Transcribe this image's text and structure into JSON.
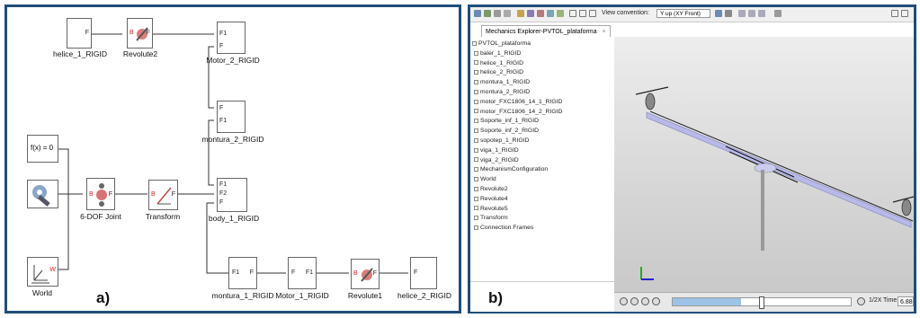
{
  "panel_a": {
    "tag": "a)",
    "blocks": {
      "helice_1": {
        "name": "helice_1_RIGID",
        "port": "F"
      },
      "revolute2": {
        "name": "Revolute2",
        "port_b": "B",
        "port_f": "F"
      },
      "motor_2": {
        "name": "Motor_2_RIGID",
        "port1": "F1",
        "port2": "F"
      },
      "montura_2": {
        "name": "montura_2_RIGID",
        "port1": "F",
        "port2": "F1"
      },
      "fx": {
        "label": "f(x) = 0"
      },
      "solver": {
        "name": ""
      },
      "dof6": {
        "name": "6-DOF Joint",
        "port_b": "B",
        "port_f": "F"
      },
      "transform": {
        "name": "Transform",
        "port_b": "B",
        "port_f": "F"
      },
      "body_1": {
        "name": "body_1_RIGID",
        "port1": "F1",
        "port2": "F2",
        "port3": "F"
      },
      "world": {
        "name": "World",
        "port": "W"
      },
      "montura_1": {
        "name": "montura_1_RIGID",
        "port1": "F1",
        "port2": "F"
      },
      "motor_1": {
        "name": "Motor_1_RIGID",
        "port1": "F",
        "port2": "F1"
      },
      "revolute1": {
        "name": "Revolute1",
        "port_b": "B",
        "port_f": "F"
      },
      "helice_2": {
        "name": "helice_2_RIGID",
        "port": "F"
      }
    }
  },
  "panel_b": {
    "tag": "b)",
    "toolbar": {
      "view_convention_label": "View convention:",
      "view_convention_value": "Y up (XY Front)"
    },
    "tab_label": "Mechanics Explorer-PVTOL_plataforma",
    "tree": [
      "PVTOL_plataforma",
      "baler_1_RIGID",
      "helice_1_RIGID",
      "helice_2_RIGID",
      "montura_1_RIGID",
      "montura_2_RIGID",
      "motor_FXC1806_14_1_RIGID",
      "motor_FXC1806_14_2_RIGID",
      "Soporte_inf_1_RIGID",
      "Soporte_inf_2_RIGID",
      "sopotep_1_RIGID",
      "viga_1_RIGID",
      "viga_2_RIGID",
      "MechanismConfiguration",
      "World",
      "Revolute2",
      "Revolute4",
      "Revolute5",
      "Transform",
      "Connection Frames"
    ],
    "playback": {
      "speed": "1/2X",
      "time_label": "Time",
      "time_value": "6.88333"
    },
    "colors": {
      "beam": "#b9b9e8",
      "accent": "#1f4e79"
    }
  }
}
